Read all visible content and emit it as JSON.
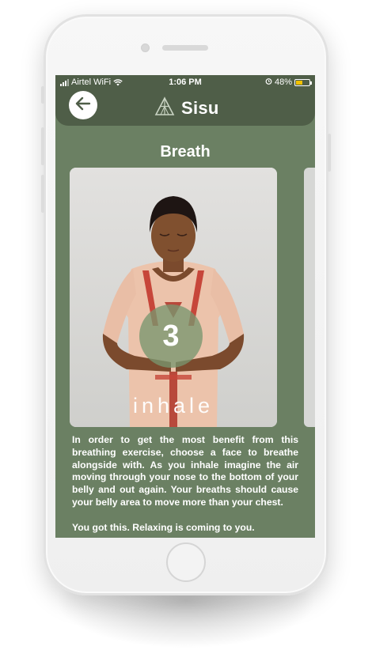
{
  "status_bar": {
    "carrier": "Airtel WiFi",
    "time": "1:06 PM",
    "battery": "48%",
    "battery_level": 0.48
  },
  "header": {
    "app_name": "Sisu",
    "back_icon": "arrow-left-icon",
    "logo_icon": "triangle-logo-icon"
  },
  "page": {
    "title": "Breath"
  },
  "exercise": {
    "count": "3",
    "phase": "inhale"
  },
  "description": {
    "paragraphs": [
      "In order to get the most benefit from this breathing exercise, choose a face to breathe alongside with. As you inhale imagine the air moving through your nose to the bottom of your belly and out again. Your breaths should cause your belly area to move more than your chest.",
      "You got this. Relaxing is coming to you."
    ]
  },
  "colors": {
    "screen_bg": "#6b8063",
    "header_bg": "#4f5e48",
    "counter_circle": "#7c9670"
  }
}
